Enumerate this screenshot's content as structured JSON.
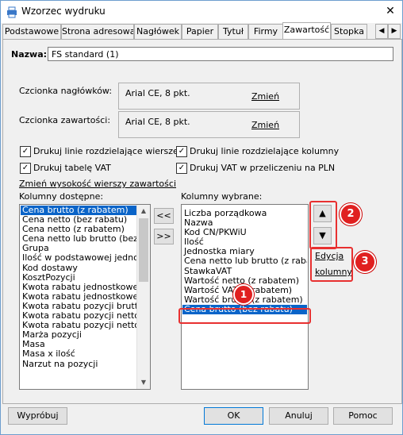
{
  "window": {
    "title": "Wzorzec wydruku",
    "close_glyph": "✕",
    "icon": "app-printer-icon"
  },
  "tabs": [
    {
      "label": "Podstawowe"
    },
    {
      "label": "Strona adresowa"
    },
    {
      "label": "Nagłówek"
    },
    {
      "label": "Papier"
    },
    {
      "label": "Tytuł"
    },
    {
      "label": "Firmy"
    },
    {
      "label": "Zawartość"
    },
    {
      "label": "Stopka"
    }
  ],
  "active_tab": "Zawartość",
  "name": {
    "label": "Nazwa:",
    "value": "FS standard (1)"
  },
  "fonts": {
    "header_label": "Czcionka nagłówków:",
    "header_value": "Arial CE, 8 pkt.",
    "header_change": "Zmień",
    "content_label": "Czcionka zawartości:",
    "content_value": "Arial CE, 8 pkt.",
    "content_change": "Zmień"
  },
  "checkboxes": [
    {
      "label": "Drukuj linie rozdzielające wiersze",
      "checked": true
    },
    {
      "label": "Drukuj linie rozdzielające kolumny",
      "checked": true
    },
    {
      "label": "Drukuj tabelę VAT",
      "checked": true
    },
    {
      "label": "Drukuj VAT w przeliczeniu na PLN",
      "checked": true
    }
  ],
  "row_height_link": "Zmień wysokość wierszy zawartości",
  "available": {
    "label": "Kolumny dostępne:",
    "items": [
      "Cena brutto (z rabatem)",
      "Cena netto (bez rabatu)",
      "Cena netto (z rabatem)",
      "Cena netto lub brutto (bez ra",
      "Grupa",
      "Ilość w podstawowej jednosto",
      "Kod dostawy",
      "KosztPozycji",
      "Kwota rabatu jednostkowego",
      "Kwota rabatu jednostkowego",
      "Kwota rabatu pozycji brutto",
      "Kwota rabatu pozycji netto",
      "Kwota rabatu pozycji netto lu",
      "Marża pozycji",
      "Masa",
      "Masa x ilość",
      "Narzut na pozycji"
    ],
    "selected_index": 0
  },
  "move": {
    "add": "<<",
    "remove": ">>"
  },
  "chosen": {
    "label": "Kolumny wybrane:",
    "items": [
      "Liczba porządkowa",
      "Nazwa",
      "Kod CN/PKWiU",
      "Ilość",
      "Jednostka miary",
      "Cena netto lub brutto (z rabat",
      "StawkaVAT",
      "Wartość netto (z rabatem)",
      "Wartość VAT (z rabatem)",
      "Wartość brutto (z rabatem)",
      "Cena brutto (bez rabatu)"
    ],
    "selected_index": 10
  },
  "order": {
    "up": "▲",
    "down": "▼"
  },
  "edit_column": {
    "line1": "Edycja",
    "line2": "kolumny"
  },
  "callouts": [
    "1",
    "2",
    "3"
  ],
  "footer": {
    "preview": "Wypróbuj",
    "ok": "OK",
    "cancel": "Anuluj",
    "help": "Pomoc"
  },
  "colors": {
    "selection": "#0a64c8",
    "callout": "#e02020",
    "frame": "#6d9ecf"
  }
}
